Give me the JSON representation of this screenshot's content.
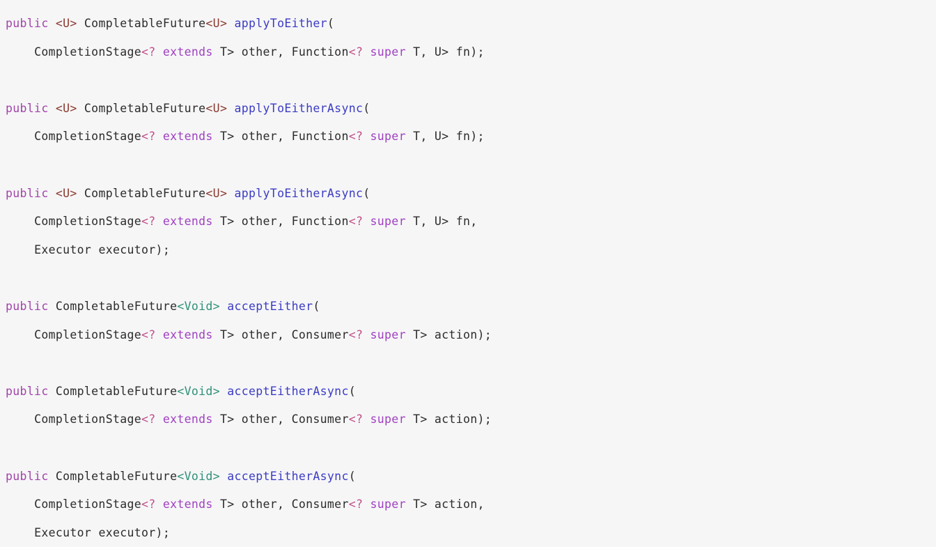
{
  "document": {
    "kind": "java-source-code-snippet",
    "language": "Java",
    "background_color": "#f6f6f7",
    "palette": {
      "keyword": "#a144a8",
      "modifier": "#a040c0",
      "type": "#2b2b2b",
      "method": "#3b3bc4",
      "generic_bracket": "#8b3a2e",
      "void_generic": "#2e9177",
      "wildcard": "#c0508a",
      "plain": "#2b2b2b"
    }
  },
  "code": {
    "lines": [
      {
        "id": "l1",
        "indent": 0,
        "tokens": [
          {
            "text": "public",
            "cls": "t-kw"
          },
          {
            "text": " ",
            "cls": "t-plain"
          },
          {
            "text": "<U>",
            "cls": "t-generic"
          },
          {
            "text": " ",
            "cls": "t-plain"
          },
          {
            "text": "CompletableFuture",
            "cls": "t-type"
          },
          {
            "text": "<U>",
            "cls": "t-generic"
          },
          {
            "text": " ",
            "cls": "t-plain"
          },
          {
            "text": "applyToEither",
            "cls": "t-method"
          },
          {
            "text": "(",
            "cls": "t-punct"
          }
        ]
      },
      {
        "id": "l2",
        "indent": 4,
        "tokens": [
          {
            "text": "CompletionStage",
            "cls": "t-type"
          },
          {
            "text": "<?",
            "cls": "t-wild"
          },
          {
            "text": " ",
            "cls": "t-plain"
          },
          {
            "text": "extends",
            "cls": "t-mod"
          },
          {
            "text": " T> other, ",
            "cls": "t-plain"
          },
          {
            "text": "Function",
            "cls": "t-type"
          },
          {
            "text": "<?",
            "cls": "t-wild"
          },
          {
            "text": " ",
            "cls": "t-plain"
          },
          {
            "text": "super",
            "cls": "t-mod"
          },
          {
            "text": " T, U> fn);",
            "cls": "t-plain"
          }
        ]
      },
      {
        "id": "l3",
        "indent": 0,
        "blank": true,
        "tokens": []
      },
      {
        "id": "l4",
        "indent": 0,
        "tokens": [
          {
            "text": "public",
            "cls": "t-kw"
          },
          {
            "text": " ",
            "cls": "t-plain"
          },
          {
            "text": "<U>",
            "cls": "t-generic"
          },
          {
            "text": " ",
            "cls": "t-plain"
          },
          {
            "text": "CompletableFuture",
            "cls": "t-type"
          },
          {
            "text": "<U>",
            "cls": "t-generic"
          },
          {
            "text": " ",
            "cls": "t-plain"
          },
          {
            "text": "applyToEitherAsync",
            "cls": "t-method"
          },
          {
            "text": "(",
            "cls": "t-punct"
          }
        ]
      },
      {
        "id": "l5",
        "indent": 4,
        "tokens": [
          {
            "text": "CompletionStage",
            "cls": "t-type"
          },
          {
            "text": "<?",
            "cls": "t-wild"
          },
          {
            "text": " ",
            "cls": "t-plain"
          },
          {
            "text": "extends",
            "cls": "t-mod"
          },
          {
            "text": " T> other, ",
            "cls": "t-plain"
          },
          {
            "text": "Function",
            "cls": "t-type"
          },
          {
            "text": "<?",
            "cls": "t-wild"
          },
          {
            "text": " ",
            "cls": "t-plain"
          },
          {
            "text": "super",
            "cls": "t-mod"
          },
          {
            "text": " T, U> fn);",
            "cls": "t-plain"
          }
        ]
      },
      {
        "id": "l6",
        "indent": 0,
        "blank": true,
        "tokens": []
      },
      {
        "id": "l7",
        "indent": 0,
        "tokens": [
          {
            "text": "public",
            "cls": "t-kw"
          },
          {
            "text": " ",
            "cls": "t-plain"
          },
          {
            "text": "<U>",
            "cls": "t-generic"
          },
          {
            "text": " ",
            "cls": "t-plain"
          },
          {
            "text": "CompletableFuture",
            "cls": "t-type"
          },
          {
            "text": "<U>",
            "cls": "t-generic"
          },
          {
            "text": " ",
            "cls": "t-plain"
          },
          {
            "text": "applyToEitherAsync",
            "cls": "t-method"
          },
          {
            "text": "(",
            "cls": "t-punct"
          }
        ]
      },
      {
        "id": "l8",
        "indent": 4,
        "tokens": [
          {
            "text": "CompletionStage",
            "cls": "t-type"
          },
          {
            "text": "<?",
            "cls": "t-wild"
          },
          {
            "text": " ",
            "cls": "t-plain"
          },
          {
            "text": "extends",
            "cls": "t-mod"
          },
          {
            "text": " T> other, ",
            "cls": "t-plain"
          },
          {
            "text": "Function",
            "cls": "t-type"
          },
          {
            "text": "<?",
            "cls": "t-wild"
          },
          {
            "text": " ",
            "cls": "t-plain"
          },
          {
            "text": "super",
            "cls": "t-mod"
          },
          {
            "text": " T, U> fn,",
            "cls": "t-plain"
          }
        ]
      },
      {
        "id": "l9",
        "indent": 4,
        "tokens": [
          {
            "text": "Executor",
            "cls": "t-type"
          },
          {
            "text": " executor);",
            "cls": "t-plain"
          }
        ]
      },
      {
        "id": "l10",
        "indent": 0,
        "blank": true,
        "tokens": []
      },
      {
        "id": "l11",
        "indent": 0,
        "tokens": [
          {
            "text": "public",
            "cls": "t-kw"
          },
          {
            "text": " ",
            "cls": "t-plain"
          },
          {
            "text": "CompletableFuture",
            "cls": "t-type"
          },
          {
            "text": "<Void>",
            "cls": "t-void"
          },
          {
            "text": " ",
            "cls": "t-plain"
          },
          {
            "text": "acceptEither",
            "cls": "t-method"
          },
          {
            "text": "(",
            "cls": "t-punct"
          }
        ]
      },
      {
        "id": "l12",
        "indent": 4,
        "tokens": [
          {
            "text": "CompletionStage",
            "cls": "t-type"
          },
          {
            "text": "<?",
            "cls": "t-wild"
          },
          {
            "text": " ",
            "cls": "t-plain"
          },
          {
            "text": "extends",
            "cls": "t-mod"
          },
          {
            "text": " T> other, ",
            "cls": "t-plain"
          },
          {
            "text": "Consumer",
            "cls": "t-type"
          },
          {
            "text": "<?",
            "cls": "t-wild"
          },
          {
            "text": " ",
            "cls": "t-plain"
          },
          {
            "text": "super",
            "cls": "t-mod"
          },
          {
            "text": " T> action);",
            "cls": "t-plain"
          }
        ]
      },
      {
        "id": "l13",
        "indent": 0,
        "blank": true,
        "tokens": []
      },
      {
        "id": "l14",
        "indent": 0,
        "tokens": [
          {
            "text": "public",
            "cls": "t-kw"
          },
          {
            "text": " ",
            "cls": "t-plain"
          },
          {
            "text": "CompletableFuture",
            "cls": "t-type"
          },
          {
            "text": "<Void>",
            "cls": "t-void"
          },
          {
            "text": " ",
            "cls": "t-plain"
          },
          {
            "text": "acceptEitherAsync",
            "cls": "t-method"
          },
          {
            "text": "(",
            "cls": "t-punct"
          }
        ]
      },
      {
        "id": "l15",
        "indent": 4,
        "tokens": [
          {
            "text": "CompletionStage",
            "cls": "t-type"
          },
          {
            "text": "<?",
            "cls": "t-wild"
          },
          {
            "text": " ",
            "cls": "t-plain"
          },
          {
            "text": "extends",
            "cls": "t-mod"
          },
          {
            "text": " T> other, ",
            "cls": "t-plain"
          },
          {
            "text": "Consumer",
            "cls": "t-type"
          },
          {
            "text": "<?",
            "cls": "t-wild"
          },
          {
            "text": " ",
            "cls": "t-plain"
          },
          {
            "text": "super",
            "cls": "t-mod"
          },
          {
            "text": " T> action);",
            "cls": "t-plain"
          }
        ]
      },
      {
        "id": "l16",
        "indent": 0,
        "blank": true,
        "tokens": []
      },
      {
        "id": "l17",
        "indent": 0,
        "tokens": [
          {
            "text": "public",
            "cls": "t-kw"
          },
          {
            "text": " ",
            "cls": "t-plain"
          },
          {
            "text": "CompletableFuture",
            "cls": "t-type"
          },
          {
            "text": "<Void>",
            "cls": "t-void"
          },
          {
            "text": " ",
            "cls": "t-plain"
          },
          {
            "text": "acceptEitherAsync",
            "cls": "t-method"
          },
          {
            "text": "(",
            "cls": "t-punct"
          }
        ]
      },
      {
        "id": "l18",
        "indent": 4,
        "tokens": [
          {
            "text": "CompletionStage",
            "cls": "t-type"
          },
          {
            "text": "<?",
            "cls": "t-wild"
          },
          {
            "text": " ",
            "cls": "t-plain"
          },
          {
            "text": "extends",
            "cls": "t-mod"
          },
          {
            "text": " T> other, ",
            "cls": "t-plain"
          },
          {
            "text": "Consumer",
            "cls": "t-type"
          },
          {
            "text": "<?",
            "cls": "t-wild"
          },
          {
            "text": " ",
            "cls": "t-plain"
          },
          {
            "text": "super",
            "cls": "t-mod"
          },
          {
            "text": " T> action,",
            "cls": "t-plain"
          }
        ]
      },
      {
        "id": "l19",
        "indent": 4,
        "tokens": [
          {
            "text": "Executor",
            "cls": "t-type"
          },
          {
            "text": " executor);",
            "cls": "t-plain"
          }
        ]
      }
    ]
  }
}
